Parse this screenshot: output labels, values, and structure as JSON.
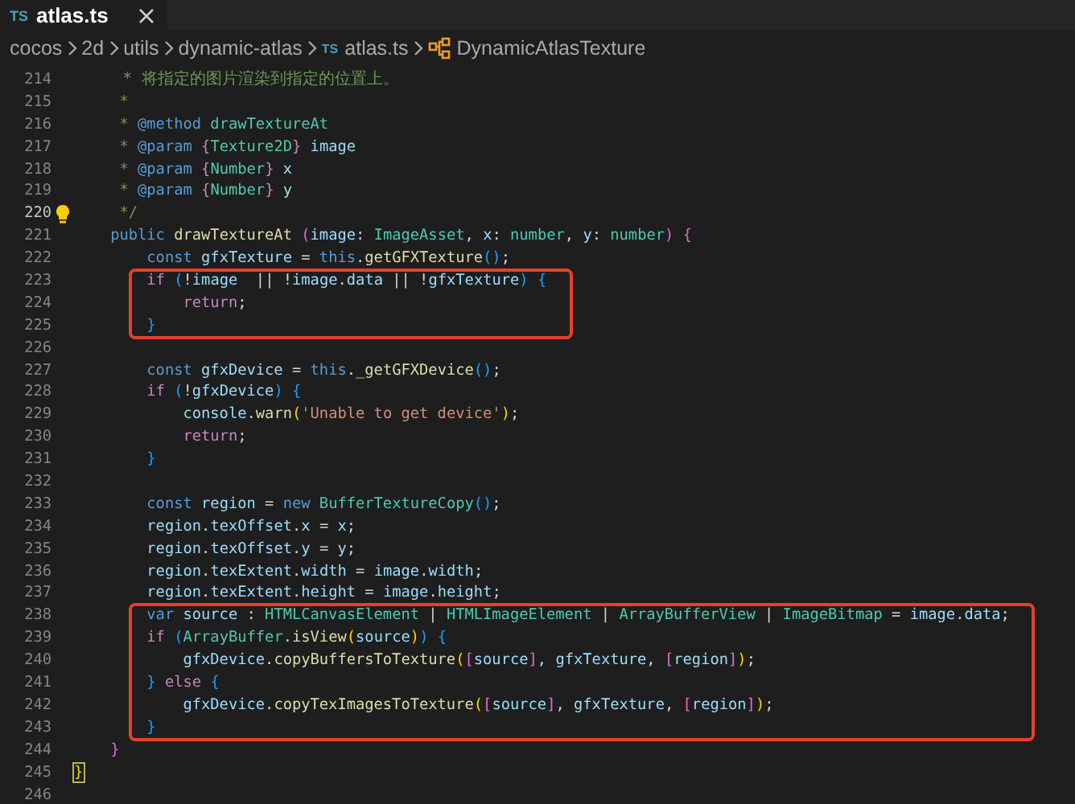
{
  "tabs": [
    {
      "badge": "TS",
      "label": "atlas.ts",
      "selected": true,
      "closable": true
    }
  ],
  "breadcrumb": [
    {
      "kind": "folder",
      "text": "cocos"
    },
    {
      "kind": "folder",
      "text": "2d"
    },
    {
      "kind": "folder",
      "text": "utils"
    },
    {
      "kind": "folder",
      "text": "dynamic-atlas"
    },
    {
      "kind": "file",
      "badge": "TS",
      "text": "atlas.ts"
    },
    {
      "kind": "symbol",
      "text": "DynamicAtlasTexture"
    }
  ],
  "editor": {
    "lines": [
      {
        "number": "214",
        "current": false,
        "boxed": false,
        "tokens": [
          {
            "text": "     * 将指定的图片渲染到指定的位置上。",
            "kind": "comment"
          }
        ]
      },
      {
        "number": "215",
        "current": false,
        "boxed": false,
        "tokens": [
          {
            "text": "     *",
            "kind": "comment"
          }
        ]
      },
      {
        "number": "216",
        "current": false,
        "boxed": false,
        "tokens": [
          {
            "text": "     * ",
            "kind": "comment"
          },
          {
            "text": "@method",
            "kind": "doctag"
          },
          {
            "text": " drawTextureAt",
            "kind": "type"
          }
        ]
      },
      {
        "number": "217",
        "current": false,
        "boxed": false,
        "tokens": [
          {
            "text": "     * ",
            "kind": "comment"
          },
          {
            "text": "@param",
            "kind": "doctag"
          },
          {
            "text": " {",
            "kind": "control"
          },
          {
            "text": "Texture2D",
            "kind": "type"
          },
          {
            "text": "}",
            "kind": "control"
          },
          {
            "text": " image",
            "kind": "var"
          }
        ]
      },
      {
        "number": "218",
        "current": false,
        "boxed": false,
        "tokens": [
          {
            "text": "     * ",
            "kind": "comment"
          },
          {
            "text": "@param",
            "kind": "doctag"
          },
          {
            "text": " {",
            "kind": "control"
          },
          {
            "text": "Number",
            "kind": "type"
          },
          {
            "text": "}",
            "kind": "control"
          },
          {
            "text": " x",
            "kind": "var"
          }
        ]
      },
      {
        "number": "219",
        "current": false,
        "boxed": false,
        "tokens": [
          {
            "text": "     * ",
            "kind": "comment"
          },
          {
            "text": "@param",
            "kind": "doctag"
          },
          {
            "text": " {",
            "kind": "control"
          },
          {
            "text": "Number",
            "kind": "type"
          },
          {
            "text": "}",
            "kind": "control"
          },
          {
            "text": " y",
            "kind": "var"
          }
        ]
      },
      {
        "number": "220",
        "current": true,
        "lightbulb": true,
        "boxed": false,
        "tokens": [
          {
            "text": "     */",
            "kind": "comment"
          }
        ]
      },
      {
        "number": "221",
        "current": false,
        "boxed": false,
        "tokens": [
          {
            "text": "    public ",
            "kind": "keyword"
          },
          {
            "text": "drawTextureAt ",
            "kind": "fn"
          },
          {
            "text": "(",
            "kind": "brace2"
          },
          {
            "text": "image",
            "kind": "var"
          },
          {
            "text": ": ",
            "kind": "punct"
          },
          {
            "text": "ImageAsset",
            "kind": "type"
          },
          {
            "text": ", ",
            "kind": "punct"
          },
          {
            "text": "x",
            "kind": "var"
          },
          {
            "text": ": ",
            "kind": "punct"
          },
          {
            "text": "number",
            "kind": "type"
          },
          {
            "text": ", ",
            "kind": "punct"
          },
          {
            "text": "y",
            "kind": "var"
          },
          {
            "text": ": ",
            "kind": "punct"
          },
          {
            "text": "number",
            "kind": "type"
          },
          {
            "text": ")",
            "kind": "brace2"
          },
          {
            "text": " {",
            "kind": "brace2"
          }
        ]
      },
      {
        "number": "222",
        "current": false,
        "boxed": false,
        "tokens": [
          {
            "text": "        const ",
            "kind": "keyword"
          },
          {
            "text": "gfxTexture",
            "kind": "var"
          },
          {
            "text": " = ",
            "kind": "punct"
          },
          {
            "text": "this",
            "kind": "keyword"
          },
          {
            "text": ".",
            "kind": "punct"
          },
          {
            "text": "getGFXTexture",
            "kind": "fn"
          },
          {
            "text": "()",
            "kind": "brace3"
          },
          {
            "text": ";",
            "kind": "punct"
          }
        ]
      },
      {
        "number": "223",
        "current": false,
        "boxed": true,
        "tokens": [
          {
            "text": "        if ",
            "kind": "control"
          },
          {
            "text": "(",
            "kind": "brace3"
          },
          {
            "text": "!",
            "kind": "punct"
          },
          {
            "text": "image",
            "kind": "var"
          },
          {
            "text": "  || !",
            "kind": "punct"
          },
          {
            "text": "image",
            "kind": "var"
          },
          {
            "text": ".",
            "kind": "punct"
          },
          {
            "text": "data",
            "kind": "var"
          },
          {
            "text": " || !",
            "kind": "punct"
          },
          {
            "text": "gfxTexture",
            "kind": "var"
          },
          {
            "text": ")",
            "kind": "brace3"
          },
          {
            "text": " {",
            "kind": "brace3"
          }
        ]
      },
      {
        "number": "224",
        "current": false,
        "boxed": true,
        "tokens": [
          {
            "text": "            return",
            "kind": "control"
          },
          {
            "text": ";",
            "kind": "punct"
          }
        ]
      },
      {
        "number": "225",
        "current": false,
        "boxed": true,
        "tokens": [
          {
            "text": "        }",
            "kind": "brace3"
          }
        ]
      },
      {
        "number": "226",
        "current": false,
        "boxed": false
      },
      {
        "number": "227",
        "current": false,
        "boxed": false,
        "tokens": [
          {
            "text": "        const ",
            "kind": "keyword"
          },
          {
            "text": "gfxDevice",
            "kind": "var"
          },
          {
            "text": " = ",
            "kind": "punct"
          },
          {
            "text": "this",
            "kind": "keyword"
          },
          {
            "text": ".",
            "kind": "punct"
          },
          {
            "text": "_getGFXDevice",
            "kind": "fn"
          },
          {
            "text": "()",
            "kind": "brace3"
          },
          {
            "text": ";",
            "kind": "punct"
          }
        ]
      },
      {
        "number": "228",
        "current": false,
        "boxed": false,
        "tokens": [
          {
            "text": "        if ",
            "kind": "control"
          },
          {
            "text": "(",
            "kind": "brace3"
          },
          {
            "text": "!",
            "kind": "punct"
          },
          {
            "text": "gfxDevice",
            "kind": "var"
          },
          {
            "text": ")",
            "kind": "brace3"
          },
          {
            "text": " {",
            "kind": "brace3"
          }
        ]
      },
      {
        "number": "229",
        "current": false,
        "boxed": false,
        "tokens": [
          {
            "text": "            console",
            "kind": "var"
          },
          {
            "text": ".",
            "kind": "punct"
          },
          {
            "text": "warn",
            "kind": "fn"
          },
          {
            "text": "(",
            "kind": "brace1"
          },
          {
            "text": "'Unable to get device'",
            "kind": "string"
          },
          {
            "text": ")",
            "kind": "brace1"
          },
          {
            "text": ";",
            "kind": "punct"
          }
        ]
      },
      {
        "number": "230",
        "current": false,
        "boxed": false,
        "tokens": [
          {
            "text": "            return",
            "kind": "control"
          },
          {
            "text": ";",
            "kind": "punct"
          }
        ]
      },
      {
        "number": "231",
        "current": false,
        "boxed": false,
        "tokens": [
          {
            "text": "        }",
            "kind": "brace3"
          }
        ]
      },
      {
        "number": "232",
        "current": false,
        "boxed": false
      },
      {
        "number": "233",
        "current": false,
        "boxed": false,
        "tokens": [
          {
            "text": "        const ",
            "kind": "keyword"
          },
          {
            "text": "region",
            "kind": "var"
          },
          {
            "text": " = ",
            "kind": "punct"
          },
          {
            "text": "new ",
            "kind": "keyword"
          },
          {
            "text": "BufferTextureCopy",
            "kind": "type"
          },
          {
            "text": "()",
            "kind": "brace3"
          },
          {
            "text": ";",
            "kind": "punct"
          }
        ]
      },
      {
        "number": "234",
        "current": false,
        "boxed": false,
        "tokens": [
          {
            "text": "        region",
            "kind": "var"
          },
          {
            "text": ".",
            "kind": "punct"
          },
          {
            "text": "texOffset",
            "kind": "var"
          },
          {
            "text": ".",
            "kind": "punct"
          },
          {
            "text": "x",
            "kind": "var"
          },
          {
            "text": " = ",
            "kind": "punct"
          },
          {
            "text": "x",
            "kind": "var"
          },
          {
            "text": ";",
            "kind": "punct"
          }
        ]
      },
      {
        "number": "235",
        "current": false,
        "boxed": false,
        "tokens": [
          {
            "text": "        region",
            "kind": "var"
          },
          {
            "text": ".",
            "kind": "punct"
          },
          {
            "text": "texOffset",
            "kind": "var"
          },
          {
            "text": ".",
            "kind": "punct"
          },
          {
            "text": "y",
            "kind": "var"
          },
          {
            "text": " = ",
            "kind": "punct"
          },
          {
            "text": "y",
            "kind": "var"
          },
          {
            "text": ";",
            "kind": "punct"
          }
        ]
      },
      {
        "number": "236",
        "current": false,
        "boxed": false,
        "tokens": [
          {
            "text": "        region",
            "kind": "var"
          },
          {
            "text": ".",
            "kind": "punct"
          },
          {
            "text": "texExtent",
            "kind": "var"
          },
          {
            "text": ".",
            "kind": "punct"
          },
          {
            "text": "width",
            "kind": "var"
          },
          {
            "text": " = ",
            "kind": "punct"
          },
          {
            "text": "image",
            "kind": "var"
          },
          {
            "text": ".",
            "kind": "punct"
          },
          {
            "text": "width",
            "kind": "var"
          },
          {
            "text": ";",
            "kind": "punct"
          }
        ]
      },
      {
        "number": "237",
        "current": false,
        "boxed": false,
        "tokens": [
          {
            "text": "        region",
            "kind": "var"
          },
          {
            "text": ".",
            "kind": "punct"
          },
          {
            "text": "texExtent",
            "kind": "var"
          },
          {
            "text": ".",
            "kind": "punct"
          },
          {
            "text": "height",
            "kind": "var"
          },
          {
            "text": " = ",
            "kind": "punct"
          },
          {
            "text": "image",
            "kind": "var"
          },
          {
            "text": ".",
            "kind": "punct"
          },
          {
            "text": "height",
            "kind": "var"
          },
          {
            "text": ";",
            "kind": "punct"
          }
        ]
      },
      {
        "number": "238",
        "current": false,
        "boxed": true,
        "tokens": [
          {
            "text": "        var ",
            "kind": "keyword"
          },
          {
            "text": "source",
            "kind": "var"
          },
          {
            "text": " : ",
            "kind": "punct"
          },
          {
            "text": "HTMLCanvasElement",
            "kind": "type"
          },
          {
            "text": " | ",
            "kind": "punct"
          },
          {
            "text": "HTMLImageElement",
            "kind": "type"
          },
          {
            "text": " | ",
            "kind": "punct"
          },
          {
            "text": "ArrayBufferView",
            "kind": "type"
          },
          {
            "text": " | ",
            "kind": "punct"
          },
          {
            "text": "ImageBitmap",
            "kind": "type"
          },
          {
            "text": " = ",
            "kind": "punct"
          },
          {
            "text": "image",
            "kind": "var"
          },
          {
            "text": ".",
            "kind": "punct"
          },
          {
            "text": "data",
            "kind": "var"
          },
          {
            "text": ";",
            "kind": "punct"
          }
        ]
      },
      {
        "number": "239",
        "current": false,
        "boxed": true,
        "tokens": [
          {
            "text": "        if ",
            "kind": "control"
          },
          {
            "text": "(",
            "kind": "brace3"
          },
          {
            "text": "ArrayBuffer",
            "kind": "type"
          },
          {
            "text": ".",
            "kind": "punct"
          },
          {
            "text": "isView",
            "kind": "fn"
          },
          {
            "text": "(",
            "kind": "brace1"
          },
          {
            "text": "source",
            "kind": "var"
          },
          {
            "text": ")",
            "kind": "brace1"
          },
          {
            "text": ")",
            "kind": "brace3"
          },
          {
            "text": " {",
            "kind": "brace3"
          }
        ]
      },
      {
        "number": "240",
        "current": false,
        "boxed": true,
        "tokens": [
          {
            "text": "            gfxDevice",
            "kind": "var"
          },
          {
            "text": ".",
            "kind": "punct"
          },
          {
            "text": "copyBuffersToTexture",
            "kind": "fn"
          },
          {
            "text": "(",
            "kind": "brace1"
          },
          {
            "text": "[",
            "kind": "brace2"
          },
          {
            "text": "source",
            "kind": "var"
          },
          {
            "text": "]",
            "kind": "brace2"
          },
          {
            "text": ", ",
            "kind": "punct"
          },
          {
            "text": "gfxTexture",
            "kind": "var"
          },
          {
            "text": ", ",
            "kind": "punct"
          },
          {
            "text": "[",
            "kind": "brace2"
          },
          {
            "text": "region",
            "kind": "var"
          },
          {
            "text": "]",
            "kind": "brace2"
          },
          {
            "text": ")",
            "kind": "brace1"
          },
          {
            "text": ";",
            "kind": "punct"
          }
        ]
      },
      {
        "number": "241",
        "current": false,
        "boxed": true,
        "tokens": [
          {
            "text": "        }",
            "kind": "brace3"
          },
          {
            "text": " else ",
            "kind": "control"
          },
          {
            "text": "{",
            "kind": "brace3"
          }
        ]
      },
      {
        "number": "242",
        "current": false,
        "boxed": true,
        "tokens": [
          {
            "text": "            gfxDevice",
            "kind": "var"
          },
          {
            "text": ".",
            "kind": "punct"
          },
          {
            "text": "copyTexImagesToTexture",
            "kind": "fn"
          },
          {
            "text": "(",
            "kind": "brace1"
          },
          {
            "text": "[",
            "kind": "brace2"
          },
          {
            "text": "source",
            "kind": "var"
          },
          {
            "text": "]",
            "kind": "brace2"
          },
          {
            "text": ", ",
            "kind": "punct"
          },
          {
            "text": "gfxTexture",
            "kind": "var"
          },
          {
            "text": ", ",
            "kind": "punct"
          },
          {
            "text": "[",
            "kind": "brace2"
          },
          {
            "text": "region",
            "kind": "var"
          },
          {
            "text": "]",
            "kind": "brace2"
          },
          {
            "text": ")",
            "kind": "brace1"
          },
          {
            "text": ";",
            "kind": "punct"
          }
        ]
      },
      {
        "number": "243",
        "current": false,
        "boxed": true,
        "tokens": [
          {
            "text": "        }",
            "kind": "brace3"
          }
        ]
      },
      {
        "number": "244",
        "current": false,
        "boxed": false,
        "tokens": [
          {
            "text": "    }",
            "kind": "brace2"
          }
        ]
      },
      {
        "number": "245",
        "current": false,
        "boxed": false,
        "tokens": [
          {
            "text": "}",
            "kind": "brace1",
            "matched": true
          }
        ]
      },
      {
        "number": "246",
        "current": false,
        "boxed": false
      }
    ]
  }
}
